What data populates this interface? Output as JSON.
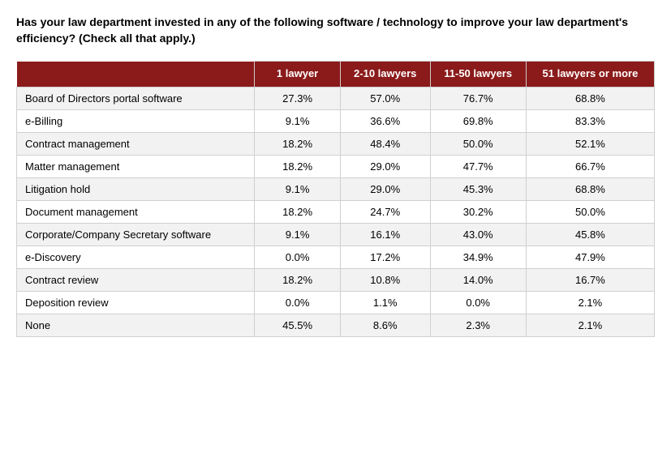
{
  "question": "Has your law department invested in any of the following software / technology to improve your law department's efficiency?  (Check all that apply.)",
  "table": {
    "headers": {
      "col1": "1 lawyer",
      "col2": "2-10 lawyers",
      "col3": "11-50 lawyers",
      "col4": "51 lawyers or more"
    },
    "rows": [
      {
        "label": "Board of Directors portal software",
        "col1": "27.3%",
        "col2": "57.0%",
        "col3": "76.7%",
        "col4": "68.8%"
      },
      {
        "label": "e-Billing",
        "col1": "9.1%",
        "col2": "36.6%",
        "col3": "69.8%",
        "col4": "83.3%"
      },
      {
        "label": "Contract management",
        "col1": "18.2%",
        "col2": "48.4%",
        "col3": "50.0%",
        "col4": "52.1%"
      },
      {
        "label": "Matter management",
        "col1": "18.2%",
        "col2": "29.0%",
        "col3": "47.7%",
        "col4": "66.7%"
      },
      {
        "label": "Litigation hold",
        "col1": "9.1%",
        "col2": "29.0%",
        "col3": "45.3%",
        "col4": "68.8%"
      },
      {
        "label": "Document management",
        "col1": "18.2%",
        "col2": "24.7%",
        "col3": "30.2%",
        "col4": "50.0%"
      },
      {
        "label": "Corporate/Company Secretary software",
        "col1": "9.1%",
        "col2": "16.1%",
        "col3": "43.0%",
        "col4": "45.8%"
      },
      {
        "label": "e-Discovery",
        "col1": "0.0%",
        "col2": "17.2%",
        "col3": "34.9%",
        "col4": "47.9%"
      },
      {
        "label": "Contract review",
        "col1": "18.2%",
        "col2": "10.8%",
        "col3": "14.0%",
        "col4": "16.7%"
      },
      {
        "label": "Deposition review",
        "col1": "0.0%",
        "col2": "1.1%",
        "col3": "0.0%",
        "col4": "2.1%"
      },
      {
        "label": "None",
        "col1": "45.5%",
        "col2": "8.6%",
        "col3": "2.3%",
        "col4": "2.1%"
      }
    ]
  }
}
